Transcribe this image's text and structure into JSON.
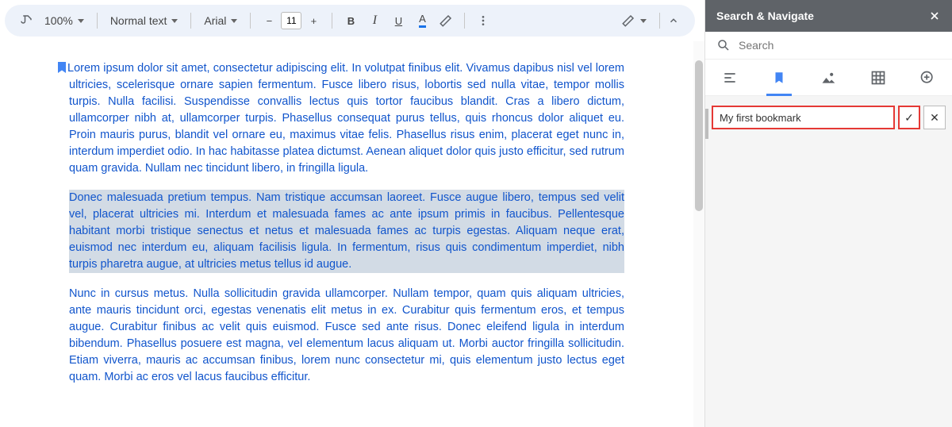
{
  "toolbar": {
    "zoom": "100%",
    "paragraph_style": "Normal text",
    "font": "Arial",
    "font_size": "11",
    "minus": "−",
    "plus": "+",
    "bold": "B",
    "italic": "I",
    "underline": "U",
    "text_color": "A"
  },
  "doc": {
    "para1": "Lorem ipsum dolor sit amet, consectetur adipiscing elit. In volutpat finibus elit. Vivamus dapibus nisl vel lorem ultricies, scelerisque ornare sapien fermentum. Fusce libero risus, lobortis sed nulla vitae, tempor mollis turpis. Nulla facilisi. Suspendisse convallis lectus quis tortor faucibus blandit. Cras a libero dictum, ullamcorper nibh at, ullamcorper turpis. Phasellus consequat purus tellus, quis rhoncus dolor aliquet eu. Proin mauris purus, blandit vel ornare eu, maximus vitae felis. Phasellus risus enim, placerat eget nunc in, interdum imperdiet odio. In hac habitasse platea dictumst. Aenean aliquet dolor quis justo efficitur, sed rutrum quam gravida. Nullam nec tincidunt libero, in fringilla ligula.",
    "para2": "Donec malesuada pretium tempus. Nam tristique accumsan laoreet. Fusce augue libero, tempus sed velit vel, placerat ultricies mi. Interdum et malesuada fames ac ante ipsum primis in faucibus. Pellentesque habitant morbi tristique senectus et netus et malesuada fames ac turpis egestas. Aliquam neque erat, euismod nec interdum eu, aliquam facilisis ligula. In fermentum, risus quis condimentum imperdiet, nibh turpis pharetra augue, at ultricies metus tellus id augue.",
    "para3": "Nunc in cursus metus. Nulla sollicitudin gravida ullamcorper. Nullam tempor, quam quis aliquam ultricies, ante mauris tincidunt orci, egestas venenatis elit metus in ex. Curabitur quis fermentum eros, et tempus augue. Curabitur finibus ac velit quis euismod. Fusce sed ante risus. Donec eleifend ligula in interdum bibendum. Phasellus posuere est magna, vel elementum lacus aliquam ut. Morbi auctor fringilla sollicitudin. Etiam viverra, mauris ac accumsan finibus, lorem nunc consectetur mi, quis elementum justo lectus eget quam. Morbi ac eros vel lacus faucibus efficitur."
  },
  "panel": {
    "title": "Search & Navigate",
    "search_placeholder": "Search",
    "bookmark_name": "My first bookmark",
    "confirm": "✓",
    "cancel": "✕"
  }
}
